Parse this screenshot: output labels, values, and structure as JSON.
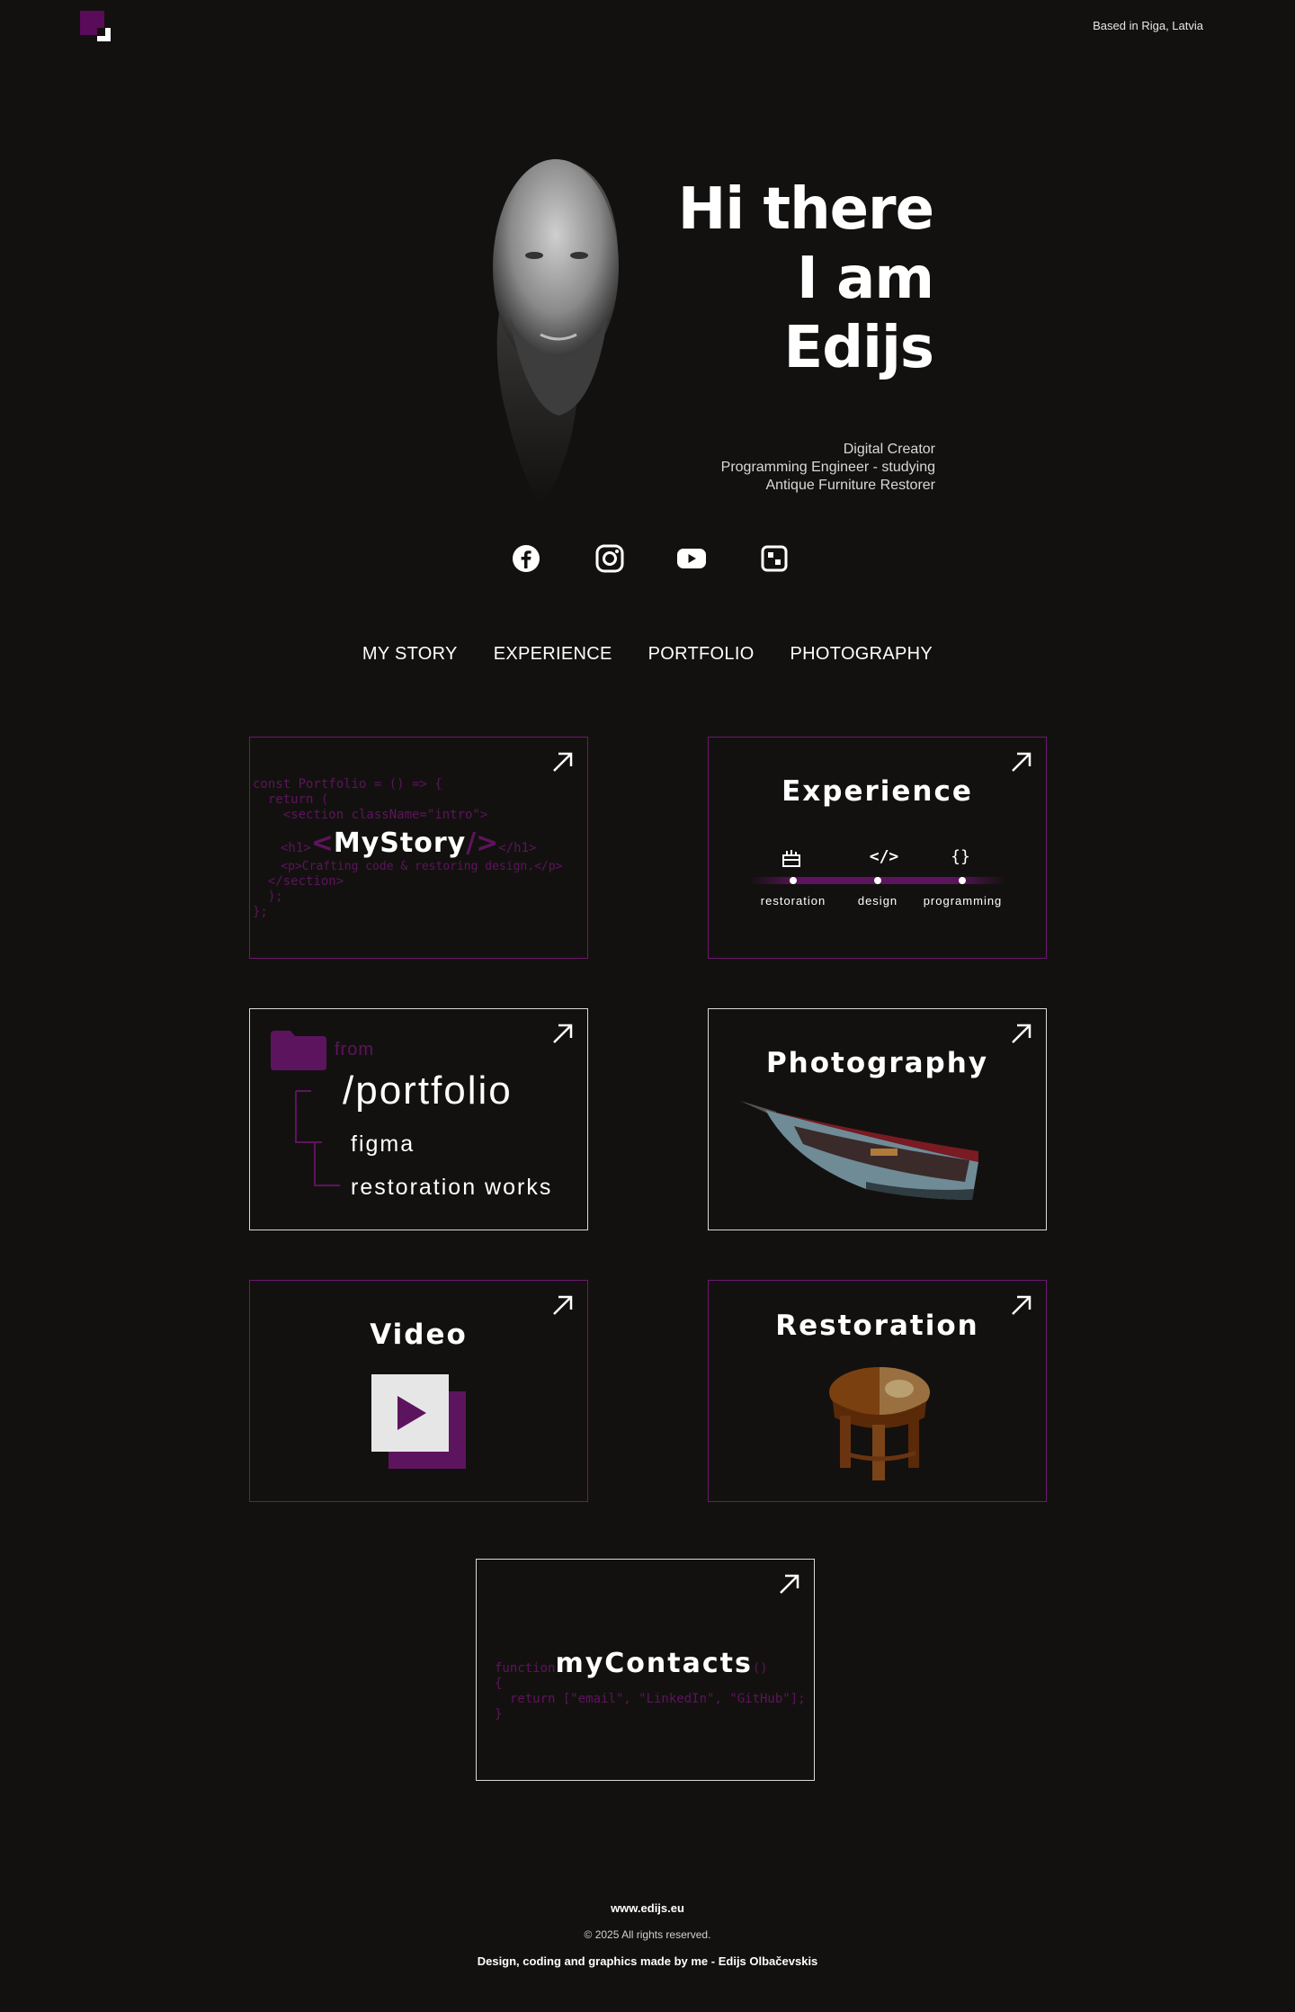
{
  "header": {
    "location": "Based in Riga, Latvia",
    "colors": {
      "background": "#13110f",
      "accent": "#5a0b5a",
      "text": "#ffffff"
    }
  },
  "hero": {
    "title_line1": "Hi there",
    "title_line2": "I am",
    "title_line3": "Edijs",
    "role1": "Digital Creator",
    "role2": "Programming Engineer - studying",
    "role3": "Antique Furniture Restorer"
  },
  "social": [
    {
      "name": "facebook-icon"
    },
    {
      "name": "instagram-icon"
    },
    {
      "name": "youtube-icon"
    },
    {
      "name": "gallery-icon"
    }
  ],
  "nav": {
    "my_story": "MY STORY",
    "experience": "EXPERIENCE",
    "portfolio": "PORTFOLIO",
    "photography": "PHOTOGRAPHY"
  },
  "cards": {
    "mystory": {
      "code_line1": "const Portfolio = () => {",
      "code_line2": "  return (",
      "code_line3": "    <section className=\"intro\">",
      "h1_open": "<h1>",
      "lt": "<",
      "title": "MyStory",
      "gt": "/>",
      "h1_close": "</h1>",
      "code_line5": "    <p>Crafting code & restoring design.</p>",
      "code_line6": "  </section>",
      "code_line7": "  );",
      "code_line8": "};"
    },
    "experience": {
      "title": "Experience",
      "icon2_text": "</>",
      "icon3_text": "{}",
      "label1": "restoration",
      "label2": "design",
      "label3": "programming"
    },
    "portfolio": {
      "from": "from",
      "path": "/portfolio",
      "item1": "figma",
      "item2": "restoration works"
    },
    "photography": {
      "title": "Photography"
    },
    "video": {
      "title": "Video"
    },
    "restoration": {
      "title": "Restoration"
    },
    "contacts": {
      "function_kw": "function",
      "title": "myContacts",
      "parens": "()",
      "brace_open": "{",
      "return_line": "  return [\"email\", \"LinkedIn\", \"GitHub\"];",
      "brace_close": "}"
    }
  },
  "footer": {
    "site": "www.edijs.eu",
    "copyright": "© 2025 All rights reserved.",
    "credit": "Design, coding and graphics made by me - Edijs Olbačevskis"
  }
}
